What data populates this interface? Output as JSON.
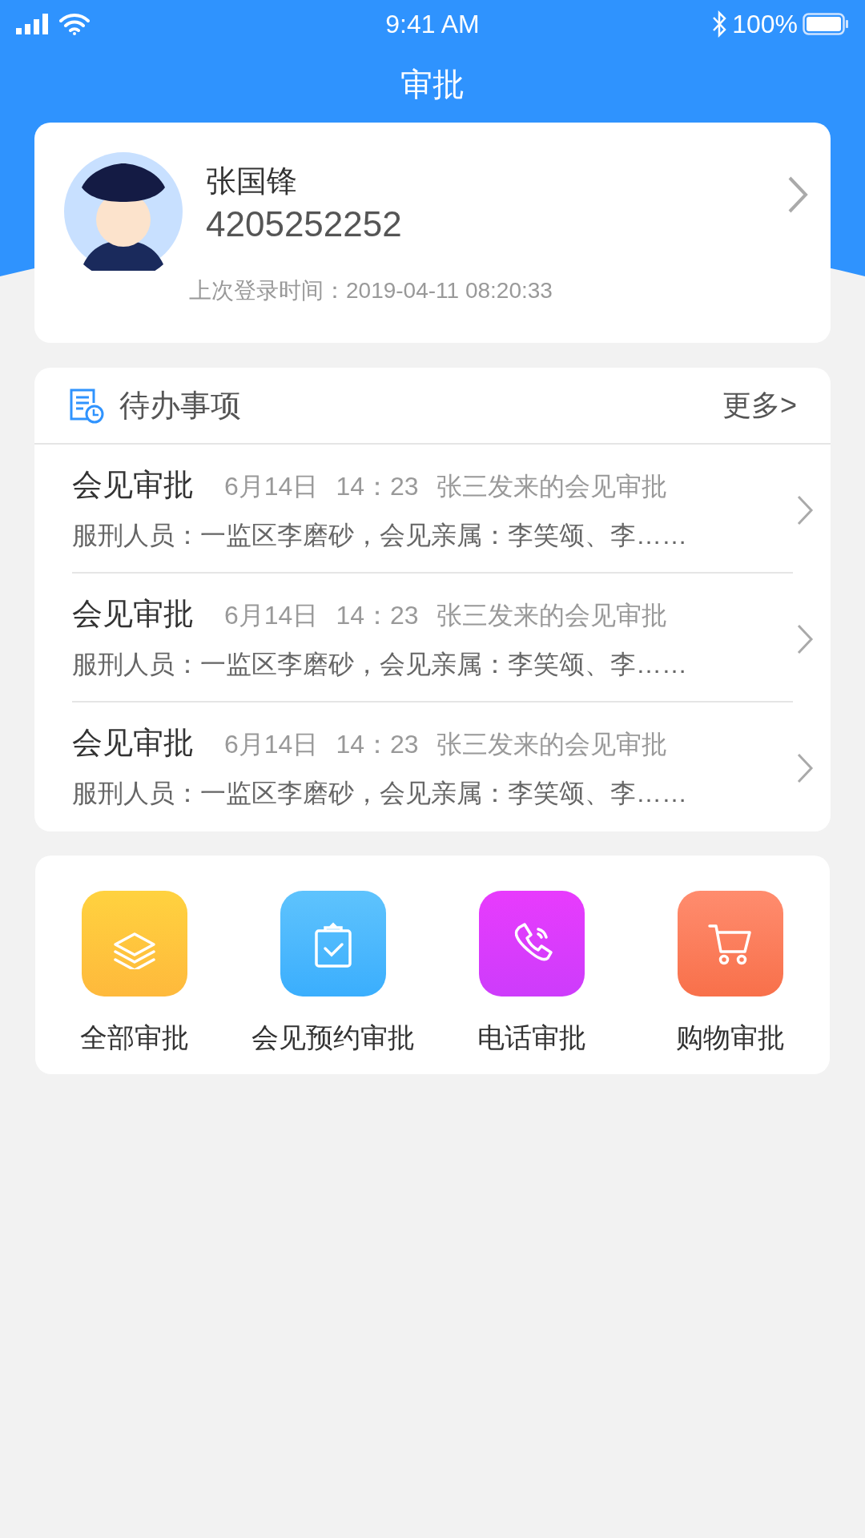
{
  "status_bar": {
    "time": "9:41 AM",
    "battery": "100%"
  },
  "title": "审批",
  "profile": {
    "name": "张国锋",
    "number": "4205252252",
    "last_login": "上次登录时间：2019-04-11 08:20:33"
  },
  "todo": {
    "title": "待办事项",
    "more": "更多>",
    "items": [
      {
        "title": "会见审批",
        "date": "6月14日",
        "time": "14：23",
        "sender": "张三发来的会见审批",
        "summary": "服刑人员：一监区李磨砂，会见亲属：李笑颂、李……"
      },
      {
        "title": "会见审批",
        "date": "6月14日",
        "time": "14：23",
        "sender": "张三发来的会见审批",
        "summary": "服刑人员：一监区李磨砂，会见亲属：李笑颂、李……"
      },
      {
        "title": "会见审批",
        "date": "6月14日",
        "time": "14：23",
        "sender": "张三发来的会见审批",
        "summary": "服刑人员：一监区李磨砂，会见亲属：李笑颂、李……"
      }
    ]
  },
  "shortcuts": [
    {
      "label": "全部审批",
      "kind": "layers"
    },
    {
      "label": "会见预约审批",
      "kind": "clipboard"
    },
    {
      "label": "电话审批",
      "kind": "phone"
    },
    {
      "label": "购物审批",
      "kind": "cart"
    }
  ]
}
